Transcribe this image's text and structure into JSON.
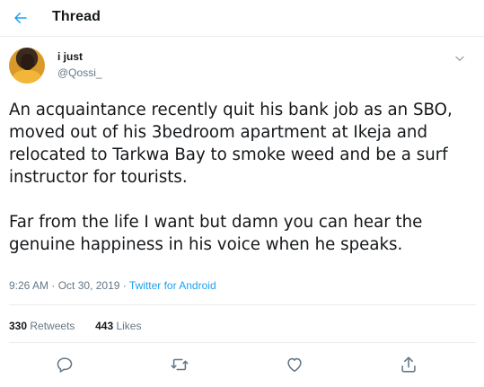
{
  "header": {
    "title": "Thread",
    "back_icon": "arrow-left-icon"
  },
  "author": {
    "display_name": "i just",
    "handle": "@Qossi_",
    "avatar": "user-avatar"
  },
  "tweet": {
    "paragraphs": [
      "An acquaintance recently quit his bank job as an SBO, moved out of his 3bedroom apartment at Ikeja and relocated to Tarkwa Bay to smoke weed and be a surf instructor for tourists.",
      "Far from the life I want but damn you can hear the genuine happiness in his voice when he speaks."
    ],
    "time": "9:26 AM",
    "date": "Oct 30, 2019",
    "separator": "·",
    "source": "Twitter for Android"
  },
  "stats": {
    "retweets_count": "330",
    "retweets_label": "Retweets",
    "likes_count": "443",
    "likes_label": "Likes"
  },
  "actions": [
    "reply-icon",
    "retweet-icon",
    "like-icon",
    "share-icon"
  ],
  "colors": {
    "accent": "#1da1f2",
    "muted": "#657786",
    "text": "#14171a",
    "border": "#e6ecf0"
  }
}
